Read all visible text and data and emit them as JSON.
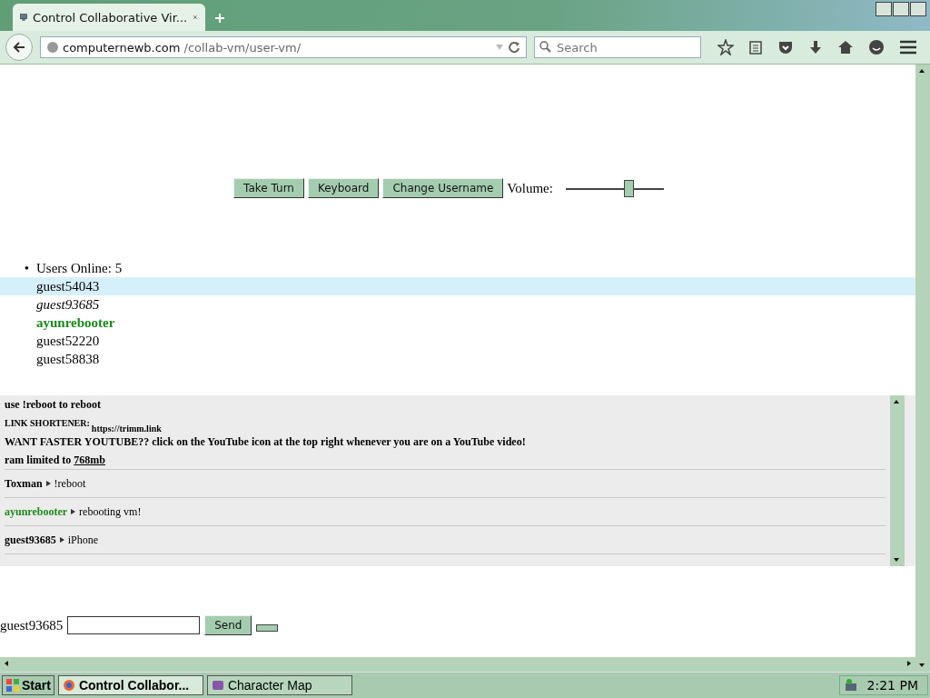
{
  "browser": {
    "tab_title": "Control Collaborative Vir...",
    "url_domain": "computernewb.com",
    "url_path": "/collab-vm/user-vm/",
    "search": {
      "placeholder": "Search"
    }
  },
  "controls": {
    "buttons": [
      "Take Turn",
      "Keyboard",
      "Change Username"
    ],
    "volume_label": "Volume:",
    "volume": {
      "level": 0.64
    }
  },
  "users": {
    "bullet": "•",
    "header": "Users Online: 5",
    "items": [
      {
        "name": "guest54043",
        "kind": "plain",
        "selected": true
      },
      {
        "name": "guest93685",
        "kind": "self",
        "selected": false
      },
      {
        "name": "ayunrebooter",
        "kind": "admin",
        "selected": false
      },
      {
        "name": "guest52220",
        "kind": "plain",
        "selected": false
      },
      {
        "name": "guest58838",
        "kind": "plain",
        "selected": false
      }
    ]
  },
  "chat": {
    "notices": [
      {
        "kind": "text",
        "text": "use !reboot to reboot"
      },
      {
        "kind": "link_shortener",
        "label": "LINK SHORTENER:",
        "link": "https://trimm.link"
      },
      {
        "kind": "text",
        "text": "WANT FASTER YOUTUBE?? click on the YouTube icon at the top right whenever you are on a YouTube video!"
      },
      {
        "kind": "ram",
        "text": "ram limited to",
        "link": "768mb"
      }
    ],
    "messages": [
      {
        "user": "Toxman",
        "color": "#000000",
        "text": "!reboot"
      },
      {
        "user": "ayunrebooter",
        "color": "#1a8a1a",
        "text": "rebooting vm!"
      },
      {
        "user": "guest93685",
        "color": "#000000",
        "text": "iPhone"
      }
    ]
  },
  "input": {
    "username": "guest93685",
    "send": "Send"
  },
  "taskbar": {
    "start": "Start",
    "tasks": [
      {
        "label": "Control Collabor...",
        "selected": true
      },
      {
        "label": "Character Map",
        "selected": false
      }
    ],
    "clock": "2:21 PM"
  }
}
